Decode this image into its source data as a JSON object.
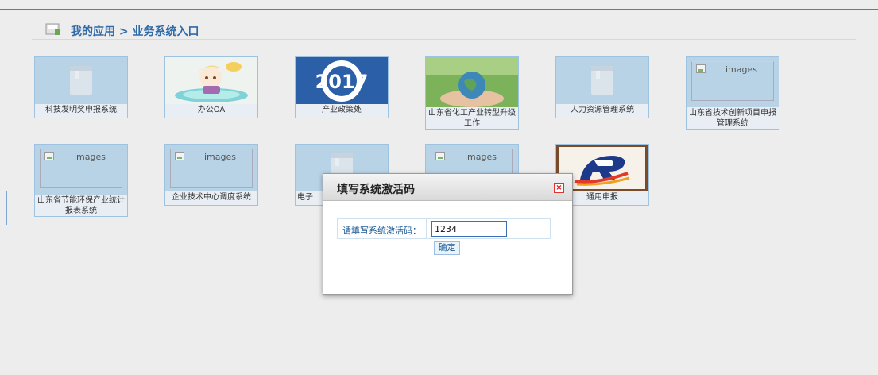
{
  "header": {
    "title": "我的应用 > 业务系统入口"
  },
  "tiles": [
    {
      "label": "科技发明奖申报系统",
      "thumb": "book-icon"
    },
    {
      "label": "办公OA",
      "thumb": "cartoon-image"
    },
    {
      "label": "产业政策处",
      "thumb": "2017-logo"
    },
    {
      "label": "山东省化工产业转型升级工作",
      "thumb": "globe-hands-image"
    },
    {
      "label": "人力资源管理系统",
      "thumb": "book-icon"
    },
    {
      "label": "山东省技术创新项目申报管理系统",
      "thumb": "broken-image",
      "alt": "images"
    },
    {
      "label": "山东省节能环保产业统计报表系统",
      "thumb": "broken-image",
      "alt": "images"
    },
    {
      "label": "企业技术中心调度系统",
      "thumb": "broken-image",
      "alt": "images"
    },
    {
      "label": "电子",
      "thumb": "book-icon"
    },
    {
      "label": "",
      "thumb": "broken-image",
      "alt": "images"
    },
    {
      "label": "通用申报",
      "thumb": "r-logo"
    }
  ],
  "logo2017": "2017",
  "modal": {
    "title": "填写系统激活码",
    "close": "×",
    "label": "请填写系统激活码：",
    "input_value": "1234",
    "ok_label": "确定"
  },
  "colors": {
    "accent": "#2f6ba8",
    "tile_bg": "#b9d3e6",
    "modal_close": "#d11111"
  }
}
